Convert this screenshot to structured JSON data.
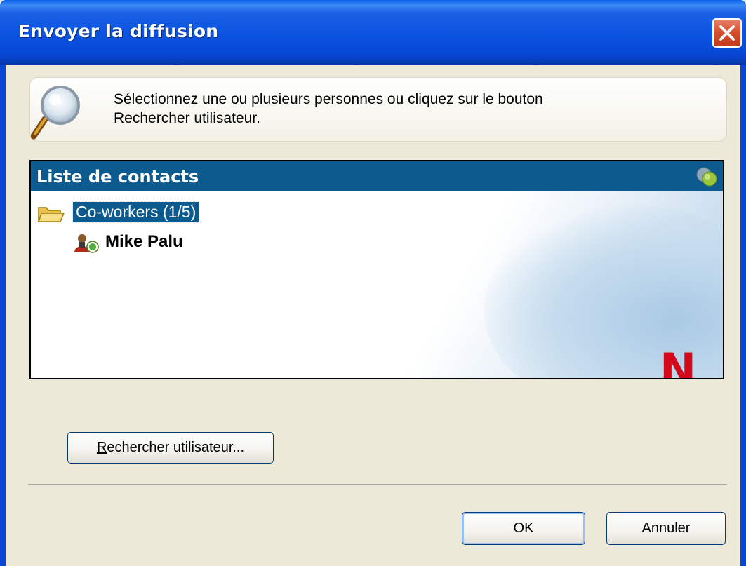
{
  "window": {
    "title": "Envoyer la diffusion"
  },
  "info": {
    "text_line1": "Sélectionnez une ou plusieurs personnes ou cliquez sur le bouton",
    "text_line2": "Rechercher utilisateur."
  },
  "contacts": {
    "header": "Liste de contacts",
    "group": {
      "label": "Co-workers  (1/5)",
      "selected": true
    },
    "items": [
      {
        "name": "Mike Palu"
      }
    ],
    "logo_letter": "N"
  },
  "buttons": {
    "search_label": "Rechercher utilisateur...",
    "ok_label": "OK",
    "cancel_label": "Annuler"
  },
  "colors": {
    "titlebar": "#0a53e0",
    "header": "#0d5a8f",
    "logo": "#d4071b",
    "dialog_bg": "#ece9d8"
  },
  "icons": {
    "close": "close-icon",
    "magnifier": "magnifier-icon",
    "status": "online-status-icon",
    "folder": "folder-open-icon",
    "user": "user-online-icon"
  }
}
